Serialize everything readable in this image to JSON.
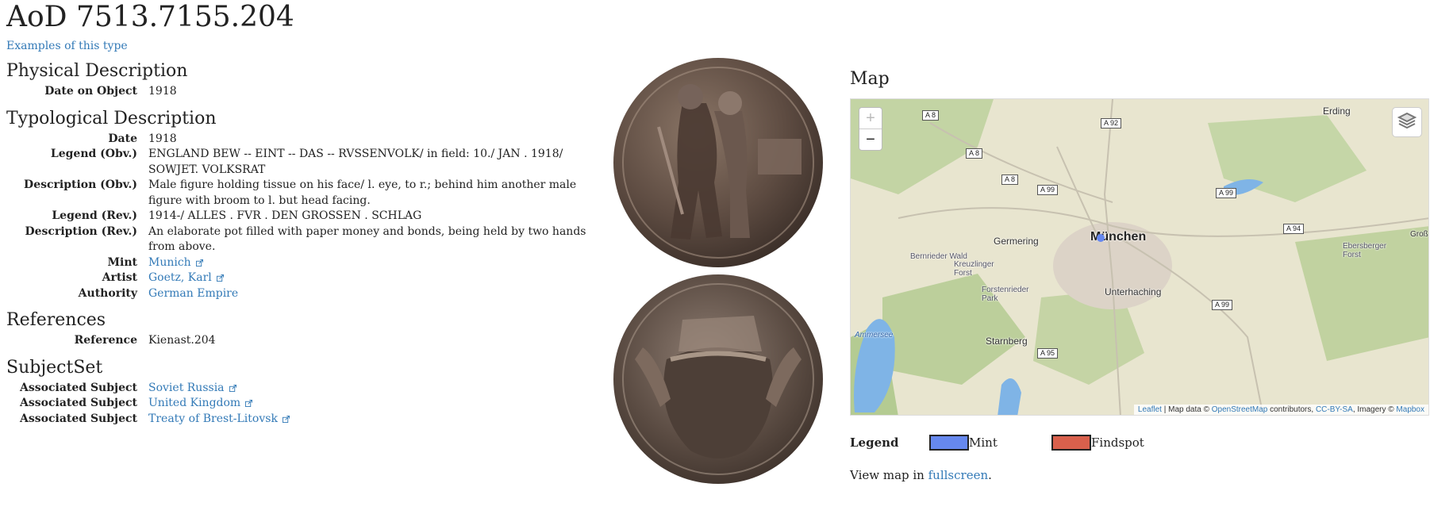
{
  "page": {
    "title": "AoD 7513.7155.204",
    "examples_link": "Examples of this type"
  },
  "physical": {
    "heading": "Physical Description",
    "rows": [
      {
        "label": "Date on Object",
        "value": "1918"
      }
    ]
  },
  "typological": {
    "heading": "Typological Description",
    "date_label": "Date",
    "date_value": "1918",
    "legend_obv_label": "Legend (Obv.)",
    "legend_obv_value": "ENGLAND BEW -- EINT -- DAS -- RVSSENVOLK/ in field: 10./ JAN . 1918/ SOWJET. VOLKSRAT",
    "desc_obv_label": "Description (Obv.)",
    "desc_obv_value": "Male figure holding tissue on his face/ l. eye, to r.; behind him another male figure with broom to l. but head facing.",
    "legend_rev_label": "Legend (Rev.)",
    "legend_rev_value": "1914-/ ALLES . FVR . DEN GROSSEN . SCHLAG",
    "desc_rev_label": "Description (Rev.)",
    "desc_rev_value": "An elaborate pot filled with paper money and bonds, being held by two hands from above.",
    "mint_label": "Mint",
    "mint_value": "Munich",
    "artist_label": "Artist",
    "artist_value": "Goetz, Karl",
    "authority_label": "Authority",
    "authority_value": "German Empire"
  },
  "references": {
    "heading": "References",
    "label": "Reference",
    "value": "Kienast.204"
  },
  "subjectset": {
    "heading": "SubjectSet",
    "items": [
      {
        "label": "Associated Subject",
        "value": "Soviet Russia"
      },
      {
        "label": "Associated Subject",
        "value": "United Kingdom"
      },
      {
        "label": "Associated Subject",
        "value": "Treaty of Brest-Litovsk"
      }
    ]
  },
  "map": {
    "heading": "Map",
    "zoom_in": "+",
    "zoom_out": "−",
    "attribution_leaflet": "Leaflet",
    "attribution_text": " | Map data © ",
    "attribution_osm": "OpenStreetMap",
    "attribution_contrib": " contributors, ",
    "attribution_ccbysa": "CC-BY-SA",
    "attribution_imagery": ", Imagery © ",
    "attribution_mapbox": "Mapbox",
    "places": {
      "munchen": "München",
      "erding": "Erding",
      "germering": "Germering",
      "unterhaching": "Unterhaching",
      "starnberg": "Starnberg",
      "bernrieder": "Bernrieder Wald",
      "kreuzlinger": "Kreuzlinger Forst",
      "forstenrieder": "Forstenrieder Park",
      "ebersberger": "Ebersberger Forst",
      "ammersee": "Ammersee",
      "gross": "Groß",
      "a8a": "A 8",
      "a8b": "A 8",
      "a8c": "A 8",
      "a92": "A 92",
      "a99a": "A 99",
      "a99b": "A 99",
      "a99c": "A 99",
      "a94": "A 94",
      "a95": "A 95"
    },
    "colors": {
      "mint": "#6688ee",
      "findspot": "#d9604c"
    }
  },
  "legend": {
    "label": "Legend",
    "mint": "Mint",
    "findspot": "Findspot"
  },
  "viewmap": {
    "prefix": "View map in ",
    "link": "fullscreen",
    "suffix": "."
  }
}
